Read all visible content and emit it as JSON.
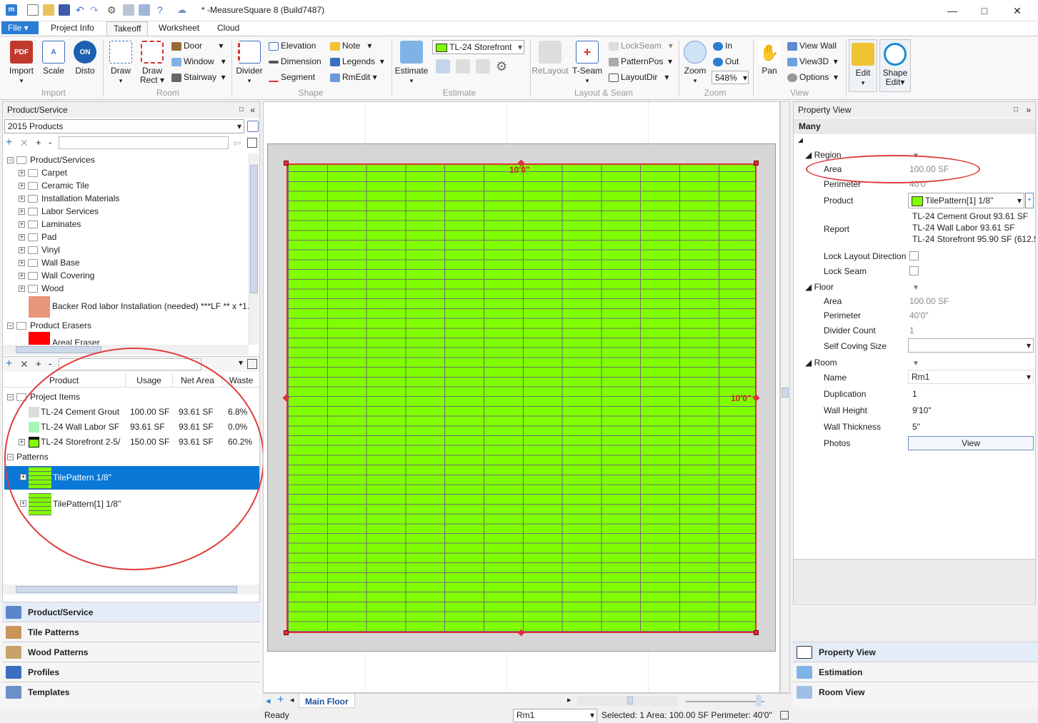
{
  "window": {
    "title": "* -MeasureSquare 8 (Build7487)",
    "min": "—",
    "max": "□",
    "close": "✕"
  },
  "tabs": {
    "file": "File ▾",
    "items": [
      "Project Info",
      "Takeoff",
      "Worksheet",
      "Cloud"
    ]
  },
  "ribbon": {
    "import": "Import",
    "scale": "Scale",
    "disto": "Disto",
    "draw": "Draw",
    "draw_rect_1": "Draw",
    "draw_rect_2": "Rect",
    "door": "Door",
    "window": "Window",
    "stairway": "Stairway",
    "divider": "Divider",
    "elevation": "Elevation",
    "dimension": "Dimension",
    "segment": "Segment",
    "note": "Note",
    "legends": "Legends",
    "rmedit": "RmEdit",
    "estimate": "Estimate",
    "product_combo": "TL-24 Storefront",
    "relayout": "ReLayout",
    "tseam": "T-Seam",
    "lockseam": "LockSeam",
    "patternpos": "PatternPos",
    "layoutdir": "LayoutDir",
    "zoom": "Zoom",
    "zoom_in": "In",
    "zoom_out": "Out",
    "zoom_level": "548%",
    "pan": "Pan",
    "view_wall": "View Wall",
    "view3d": "View3D",
    "options": "Options",
    "edit": "Edit",
    "shape_edit_1": "Shape",
    "shape_edit_2": "Edit",
    "groups": {
      "import": "Import",
      "room": "Room",
      "shape": "Shape",
      "estimate": "Estimate",
      "layout": "Layout & Seam",
      "zoom": "Zoom",
      "view": "View"
    }
  },
  "left": {
    "title": "Product/Service",
    "catalog": "2015 Products",
    "tree_root": "Product/Services",
    "tree_items": [
      "Carpet",
      "Ceramic Tile",
      "Installation Materials",
      "Labor Services",
      "Laminates",
      "Pad",
      "Vinyl",
      "Wall Base",
      "Wall Covering",
      "Wood"
    ],
    "backer_rod": "Backer Rod labor Installation (needed)  ***LF ** x *1.",
    "erasers": "Product Erasers",
    "areal_eraser": "Areal Eraser",
    "grid_headers": [
      "Product",
      "Usage",
      "Net Area",
      "Waste"
    ],
    "project_items": "Project Items",
    "rows": [
      {
        "product": "TL-24 Cement Grout",
        "usage": "100.00 SF",
        "net": "93.61 SF",
        "waste": "6.8%"
      },
      {
        "product": "TL-24 Wall Labor  SF",
        "usage": "93.61 SF",
        "net": "93.61 SF",
        "waste": "0.0%"
      },
      {
        "product": "TL-24 Storefront 2-5/",
        "usage": "150.00 SF",
        "net": "93.61 SF",
        "waste": "60.2%"
      }
    ],
    "patterns": "Patterns",
    "pattern1": "TilePattern 1/8\"",
    "pattern2": "TilePattern[1] 1/8\"",
    "nav": [
      "Product/Service",
      "Tile Patterns",
      "Wood Patterns",
      "Profiles",
      "Templates"
    ]
  },
  "canvas": {
    "dim_top": "10'0\"",
    "dim_right": "10'0\"",
    "floor_tab": "Main Floor"
  },
  "property": {
    "title": "Property View",
    "many": "Many",
    "region": "Region",
    "area_label": "Area",
    "area_value": "100.00 SF",
    "perimeter_label": "Perimeter",
    "perimeter_value": "40'0\"",
    "product_label": "Product",
    "product_value": "TilePattern[1] 1/8\"",
    "report_label": "Report",
    "report_lines": [
      "TL-24 Cement Grout 93.61 SF",
      "TL-24 Wall Labor 93.61 SF",
      "TL-24 Storefront 95.90 SF (612.5"
    ],
    "lock_layout": "Lock Layout Direction",
    "lock_seam": "Lock Seam",
    "floor": "Floor",
    "floor_area_label": "Area",
    "floor_area": "100.00 SF",
    "floor_perimeter_label": "Perimeter",
    "floor_perimeter": "40'0\"",
    "divider_count_label": "Divider Count",
    "divider_count": "1",
    "self_coving_label": "Self Coving Size",
    "room": "Room",
    "name_label": "Name",
    "name_value": "Rm1",
    "duplication_label": "Duplication",
    "duplication": "1",
    "wall_height_label": "Wall Height",
    "wall_height": "9'10\"",
    "wall_thickness_label": "Wall Thickness",
    "wall_thickness": "5\"",
    "photos_label": "Photos",
    "view_btn": "View",
    "nav": [
      "Property View",
      "Estimation",
      "Room View"
    ]
  },
  "status": {
    "ready": "Ready",
    "room": "Rm1",
    "selection": "Selected: 1 Area: 100.00 SF Perimeter: 40'0\""
  },
  "colors": {
    "accent": "#2b7cd3",
    "tile_green": "#80ff00",
    "selection_blue": "#0a78d7",
    "highlight_red": "#e03c3c"
  }
}
